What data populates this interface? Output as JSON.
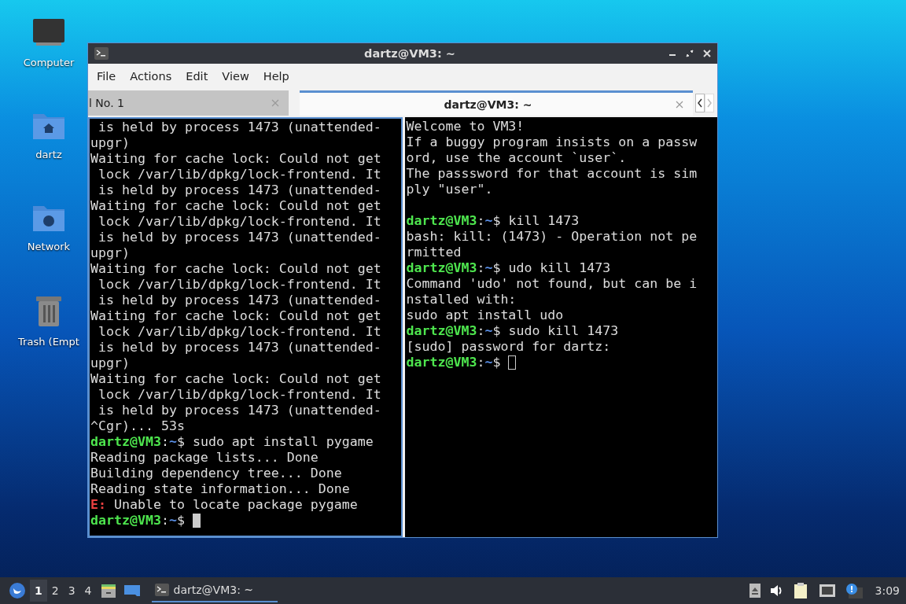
{
  "desktop_icons": [
    {
      "kind": "computer",
      "label": "Computer"
    },
    {
      "kind": "home",
      "label": "dartz"
    },
    {
      "kind": "network",
      "label": "Network"
    },
    {
      "kind": "trash",
      "label": "Trash (Empt"
    }
  ],
  "window": {
    "title": "dartz@VM3: ~"
  },
  "menu": [
    "File",
    "Actions",
    "Edit",
    "View",
    "Help"
  ],
  "tabs": [
    {
      "label": "l No. 1",
      "selected": false
    },
    {
      "label": "dartz@VM3: ~",
      "selected": true
    }
  ],
  "panes": [
    {
      "focused": true,
      "lines": [
        {
          "kind": "output",
          "text": " is held by process 1473 (unattended-"
        },
        {
          "kind": "output",
          "text": "upgr)"
        },
        {
          "kind": "output",
          "text": "Waiting for cache lock: Could not get"
        },
        {
          "kind": "output",
          "text": " lock /var/lib/dpkg/lock-frontend. It"
        },
        {
          "kind": "output",
          "text": " is held by process 1473 (unattended-"
        },
        {
          "kind": "output",
          "text": "Waiting for cache lock: Could not get"
        },
        {
          "kind": "output",
          "text": " lock /var/lib/dpkg/lock-frontend. It"
        },
        {
          "kind": "output",
          "text": " is held by process 1473 (unattended-"
        },
        {
          "kind": "output",
          "text": "upgr)"
        },
        {
          "kind": "output",
          "text": "Waiting for cache lock: Could not get"
        },
        {
          "kind": "output",
          "text": " lock /var/lib/dpkg/lock-frontend. It"
        },
        {
          "kind": "output",
          "text": " is held by process 1473 (unattended-"
        },
        {
          "kind": "output",
          "text": "Waiting for cache lock: Could not get"
        },
        {
          "kind": "output",
          "text": " lock /var/lib/dpkg/lock-frontend. It"
        },
        {
          "kind": "output",
          "text": " is held by process 1473 (unattended-"
        },
        {
          "kind": "output",
          "text": "upgr)"
        },
        {
          "kind": "output",
          "text": "Waiting for cache lock: Could not get"
        },
        {
          "kind": "output",
          "text": " lock /var/lib/dpkg/lock-frontend. It"
        },
        {
          "kind": "output",
          "text": " is held by process 1473 (unattended-"
        },
        {
          "kind": "output",
          "text": "^Cgr)... 53s"
        },
        {
          "kind": "prompt",
          "user": "dartz@VM3",
          "separator": ":",
          "path": "~",
          "symbol": "$",
          "command": "sudo apt install pygame"
        },
        {
          "kind": "output",
          "text": "Reading package lists... Done"
        },
        {
          "kind": "output",
          "text": "Building dependency tree... Done"
        },
        {
          "kind": "output",
          "text": "Reading state information... Done"
        },
        {
          "kind": "error",
          "label": "E:",
          "text": "Unable to locate package pygame"
        },
        {
          "kind": "prompt",
          "user": "dartz@VM3",
          "separator": ":",
          "path": "~",
          "symbol": "$",
          "cursor": true
        }
      ]
    },
    {
      "focused": false,
      "lines": [
        {
          "kind": "output",
          "text": "Welcome to VM3!"
        },
        {
          "kind": "output",
          "text": "If a buggy program insists on a passw"
        },
        {
          "kind": "output",
          "text": "ord, use the account `user`."
        },
        {
          "kind": "output",
          "text": "The passsword for that account is sim"
        },
        {
          "kind": "output",
          "text": "ply \"user\"."
        },
        {
          "kind": "blank"
        },
        {
          "kind": "prompt",
          "user": "dartz@VM3",
          "separator": ":",
          "path": "~",
          "symbol": "$",
          "command": "kill 1473"
        },
        {
          "kind": "output",
          "text": "bash: kill: (1473) - Operation not pe"
        },
        {
          "kind": "output",
          "text": "rmitted"
        },
        {
          "kind": "prompt",
          "user": "dartz@VM3",
          "separator": ":",
          "path": "~",
          "symbol": "$",
          "command": "udo kill 1473"
        },
        {
          "kind": "output",
          "text": "Command 'udo' not found, but can be i"
        },
        {
          "kind": "output",
          "text": "nstalled with:"
        },
        {
          "kind": "output",
          "text": "sudo apt install udo"
        },
        {
          "kind": "prompt",
          "user": "dartz@VM3",
          "separator": ":",
          "path": "~",
          "symbol": "$",
          "command": "sudo kill 1473"
        },
        {
          "kind": "output",
          "text": "[sudo] password for dartz:"
        },
        {
          "kind": "prompt",
          "user": "dartz@VM3",
          "separator": ":",
          "path": "~",
          "symbol": "$",
          "cursor": true
        }
      ]
    }
  ],
  "taskbar": {
    "workspaces": [
      {
        "label": "1",
        "selected": true
      },
      {
        "label": "2",
        "selected": false
      },
      {
        "label": "3",
        "selected": false
      },
      {
        "label": "4",
        "selected": false
      }
    ],
    "task": "dartz@VM3: ~",
    "clock": "3:09"
  }
}
